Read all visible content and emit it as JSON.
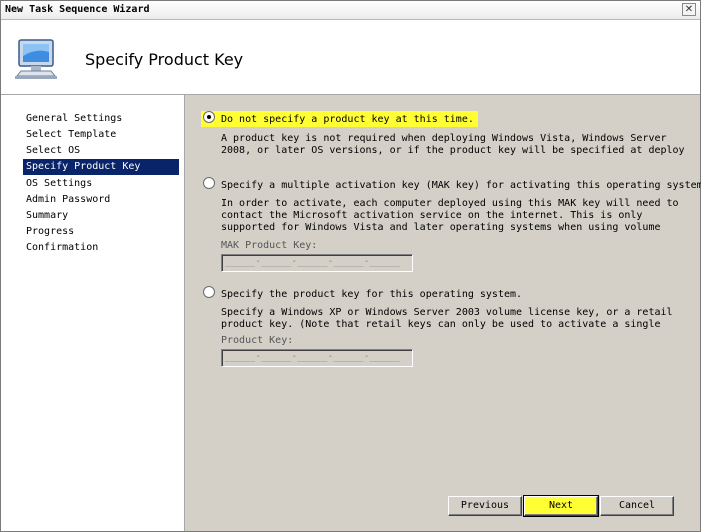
{
  "window": {
    "title": "New Task Sequence Wizard",
    "close_label": "✕"
  },
  "header": {
    "page_title": "Specify Product Key"
  },
  "nav": {
    "items": [
      {
        "label": "General Settings"
      },
      {
        "label": "Select Template"
      },
      {
        "label": "Select OS"
      },
      {
        "label": "Specify Product Key",
        "selected": true
      },
      {
        "label": "OS Settings"
      },
      {
        "label": "Admin Password"
      },
      {
        "label": "Summary"
      },
      {
        "label": "Progress"
      },
      {
        "label": "Confirmation"
      }
    ]
  },
  "options": {
    "none": {
      "label": "Do not specify a product key at this time.",
      "desc_line1": "A product key is not required when deploying Windows Vista, Windows Server",
      "desc_line2": "2008, or later OS versions, or if the product key will be specified at deploy",
      "selected": true
    },
    "mak": {
      "label": "Specify a multiple activation key (MAK key) for activating this operating system.",
      "desc_line1": "In order to activate, each computer deployed using this MAK key will need to",
      "desc_line2": "contact the Microsoft activation service on the internet.  This is only",
      "desc_line3": "supported for Windows Vista and later operating systems when using volume",
      "field_label": "MAK Product Key:",
      "field_mask": "_____-_____-_____-_____-_____"
    },
    "retail": {
      "label": "Specify the product key for this operating system.",
      "desc_line1": "Specify a Windows XP or Windows Server 2003 volume license key, or a retail",
      "desc_line2": "product key.  (Note that retail keys can only be used to activate a single",
      "field_label": "Product Key:",
      "field_mask": "_____-_____-_____-_____-_____"
    }
  },
  "buttons": {
    "previous": "Previous",
    "next": "Next",
    "cancel": "Cancel"
  },
  "colors": {
    "highlight": "#ffff33",
    "nav_selected": "#0a246a",
    "dialog_bg": "#d4d0c8"
  }
}
